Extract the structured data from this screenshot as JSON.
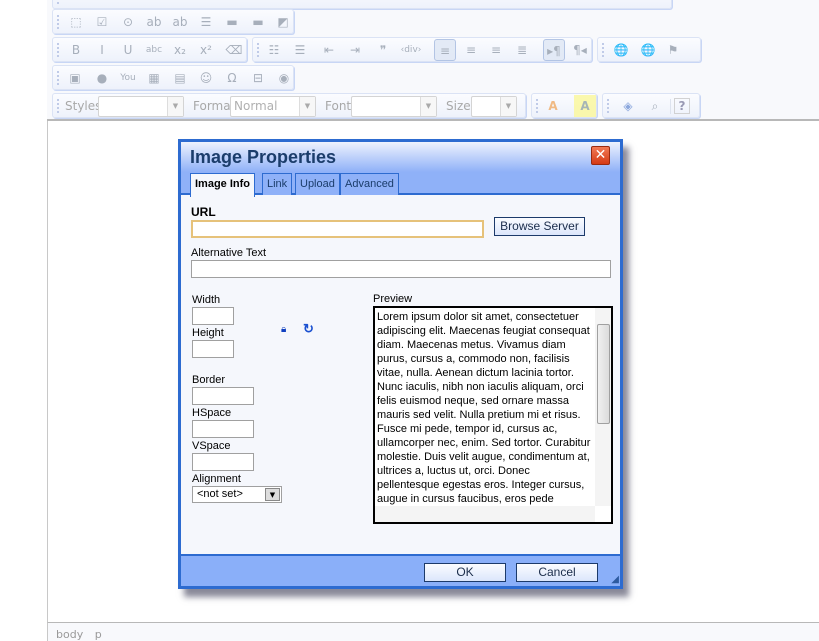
{
  "toolbar": {
    "row1": [
      {
        "name": "form-icon",
        "g": "⬚"
      },
      {
        "name": "checkbox-icon",
        "g": "☑"
      },
      {
        "name": "radio-icon",
        "g": "⊙"
      },
      {
        "name": "textfield-icon",
        "g": "ab"
      },
      {
        "name": "textarea-icon",
        "g": "ab"
      },
      {
        "name": "select-icon",
        "g": "☰"
      },
      {
        "name": "button-icon",
        "g": "▬"
      },
      {
        "name": "imagebutton-icon",
        "g": "▬"
      },
      {
        "name": "hiddenfield-icon",
        "g": "◩"
      }
    ],
    "row2a": [
      {
        "name": "bold-icon",
        "g": "B"
      },
      {
        "name": "italic-icon",
        "g": "I"
      },
      {
        "name": "underline-icon",
        "g": "U"
      },
      {
        "name": "strike-icon",
        "g": "abc"
      },
      {
        "name": "subscript-icon",
        "g": "x₂"
      },
      {
        "name": "superscript-icon",
        "g": "x²"
      },
      {
        "name": "remove-format-icon",
        "g": "⌫"
      }
    ],
    "row2b": [
      {
        "name": "numbered-list-icon",
        "g": "☷"
      },
      {
        "name": "bulleted-list-icon",
        "g": "☰"
      },
      {
        "name": "outdent-icon",
        "g": "⇤"
      },
      {
        "name": "indent-icon",
        "g": "⇥"
      },
      {
        "name": "blockquote-icon",
        "g": "❞"
      },
      {
        "name": "div-icon",
        "g": "‹div›"
      },
      {
        "name": "align-left-icon",
        "g": "≡"
      },
      {
        "name": "align-center-icon",
        "g": "≡"
      },
      {
        "name": "align-right-icon",
        "g": "≡"
      },
      {
        "name": "justify-icon",
        "g": "≣"
      },
      {
        "name": "ltr-icon",
        "g": "▸¶"
      },
      {
        "name": "rtl-icon",
        "g": "¶◂"
      }
    ],
    "row2c": [
      {
        "name": "link-icon",
        "g": "🌐"
      },
      {
        "name": "unlink-icon",
        "g": "🌐"
      },
      {
        "name": "anchor-flag-icon",
        "g": "⚑"
      }
    ],
    "row3": [
      {
        "name": "image-icon",
        "g": "▣"
      },
      {
        "name": "flash-icon",
        "g": "●"
      },
      {
        "name": "youtube-icon",
        "g": "You"
      },
      {
        "name": "table-icon",
        "g": "▦"
      },
      {
        "name": "horizontal-rule-icon",
        "g": "▤"
      },
      {
        "name": "smiley-icon",
        "g": "☺"
      },
      {
        "name": "special-char-icon",
        "g": "Ω"
      },
      {
        "name": "page-break-icon",
        "g": "⊟"
      },
      {
        "name": "iframe-icon",
        "g": "◉"
      }
    ],
    "styles_label": "Styles",
    "format_label": "Format",
    "format_value": "Normal",
    "font_label": "Font",
    "size_label": "Size",
    "text_color": "A",
    "bg_color": "A",
    "maximize": "◈",
    "preview": "⌕",
    "about": "?"
  },
  "status": {
    "path": "body p"
  },
  "dialog": {
    "title": "Image Properties",
    "close": "✕",
    "tabs": [
      "Image Info",
      "Link",
      "Upload",
      "Advanced"
    ],
    "url_label": "URL",
    "browse": "Browse Server",
    "alt_label": "Alternative Text",
    "width_label": "Width",
    "height_label": "Height",
    "border_label": "Border",
    "hspace_label": "HSpace",
    "vspace_label": "VSpace",
    "alignment_label": "Alignment",
    "alignment_value": "<not set>",
    "preview_label": "Preview",
    "preview_text": "Lorem ipsum dolor sit amet, consectetuer adipiscing elit. Maecenas feugiat consequat diam. Maecenas metus. Vivamus diam purus, cursus a, commodo non, facilisis vitae, nulla. Aenean dictum lacinia tortor. Nunc iaculis, nibh non iaculis aliquam, orci felis euismod neque, sed ornare massa mauris sed velit. Nulla pretium mi et risus. Fusce mi pede, tempor id, cursus ac, ullamcorper nec, enim. Sed tortor. Curabitur molestie. Duis velit augue, condimentum at, ultrices a, luctus ut, orci. Donec pellentesque egestas eros. Integer cursus, augue in cursus faucibus, eros pede bibendum sem, in tempus tellus justo quis ligula. Etiam eget tortor. Vestibulum",
    "ok": "OK",
    "cancel": "Cancel"
  }
}
